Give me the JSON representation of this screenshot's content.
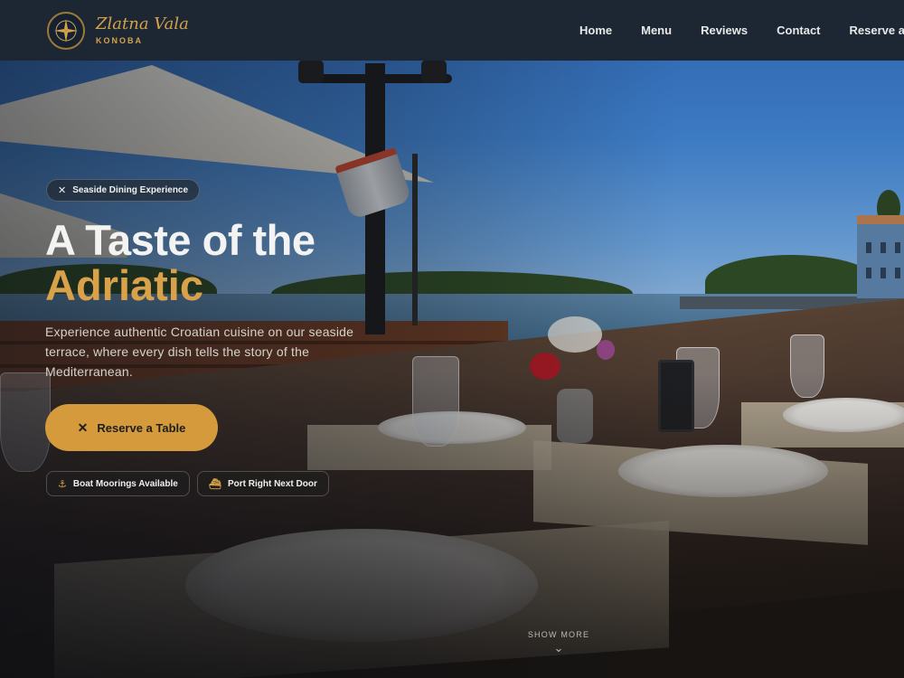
{
  "header": {
    "logo_script": "Zlatna Vala",
    "logo_sub": "KONOBA",
    "logo_icon": "compass-rose-icon",
    "nav": [
      "Home",
      "Menu",
      "Reviews",
      "Contact",
      "Reserve a Table"
    ]
  },
  "hero": {
    "badge": {
      "icon": "utensils-icon",
      "label": "Seaside Dining Experience"
    },
    "title_line1": "A Taste of the",
    "title_line2": "Adriatic",
    "subtitle": "Experience authentic Croatian cuisine on our seaside terrace, where every dish tells the story of the Mediterranean.",
    "cta": {
      "icon": "utensils-icon",
      "label": "Reserve a Table"
    },
    "features": [
      {
        "icon": "anchor-icon",
        "label": "Boat Moorings Available"
      },
      {
        "icon": "boat-icon",
        "label": "Port Right Next Door"
      }
    ],
    "show_more": "SHOW MORE"
  },
  "colors": {
    "accent": "#d49a3c",
    "header_bg": "#1d2733",
    "title": "#f3f3f3"
  }
}
